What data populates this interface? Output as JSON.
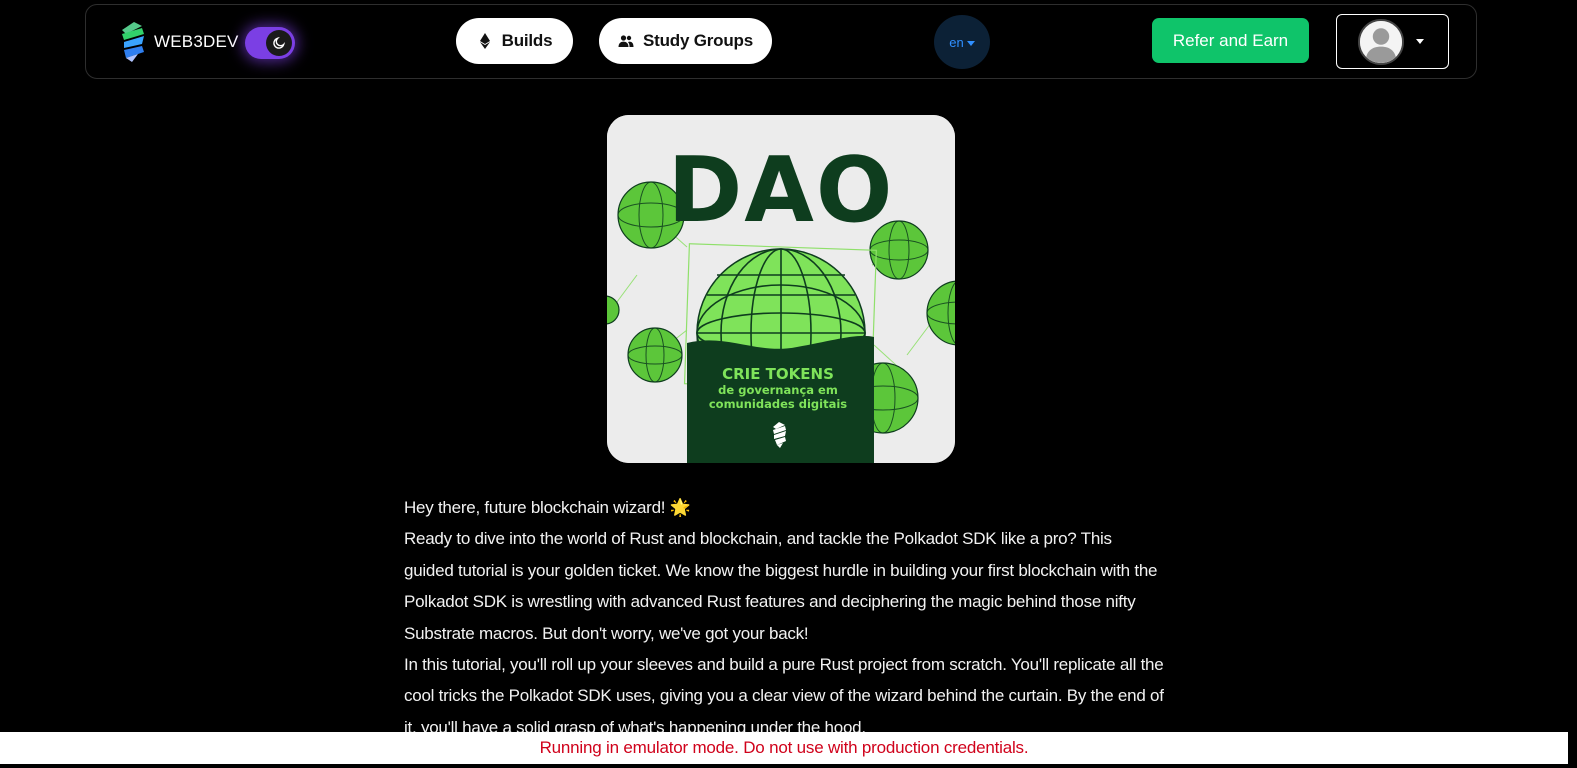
{
  "header": {
    "brand_name": "WEB3DEV",
    "brand_logo_icon": "web3dev-logo-icon",
    "theme_toggle_icon": "moon-icon",
    "nav": [
      {
        "label": "Builds",
        "icon": "ethereum-icon"
      },
      {
        "label": "Study Groups",
        "icon": "people-icon"
      }
    ],
    "language": {
      "value": "en",
      "icon": "caret-down-icon"
    },
    "refer_label": "Refer and Earn",
    "account": {
      "avatar_icon": "user-avatar-icon",
      "caret_icon": "caret-down-icon"
    }
  },
  "cover": {
    "title": "DAO",
    "subtitle": "CRIE TOKENS",
    "caption_line1": "de governança em",
    "caption_line2": "comunidades digitais",
    "emblem_icon": "web3dev-logo-icon"
  },
  "description": {
    "paragraphs": [
      "Hey there, future blockchain wizard! 🌟",
      "Ready to dive into the world of Rust and blockchain, and tackle the Polkadot SDK like a pro? This guided tutorial is your golden ticket. We know the biggest hurdle in building your first blockchain with the Polkadot SDK is wrestling with advanced Rust features and deciphering the magic behind those nifty Substrate macros. But don't worry, we've got your back!",
      "In this tutorial, you'll roll up your sleeves and build a pure Rust project from scratch. You'll replicate all the cool tricks the Polkadot SDK uses, giving you a clear view of the wizard behind the curtain. By the end of it, you'll have a solid grasp of what's happening under the hood."
    ]
  },
  "banner": {
    "text": "Running in emulator mode. Do not use with production credentials."
  },
  "colors": {
    "refer_button": "#0fc46a",
    "theme_toggle": "#7b3fe4",
    "language_bg": "#0c2136",
    "language_text": "#2f8fff",
    "banner_text": "#d0021b",
    "cover_dark_green": "#0e3d1e",
    "cover_light_green": "#7fe35a"
  }
}
